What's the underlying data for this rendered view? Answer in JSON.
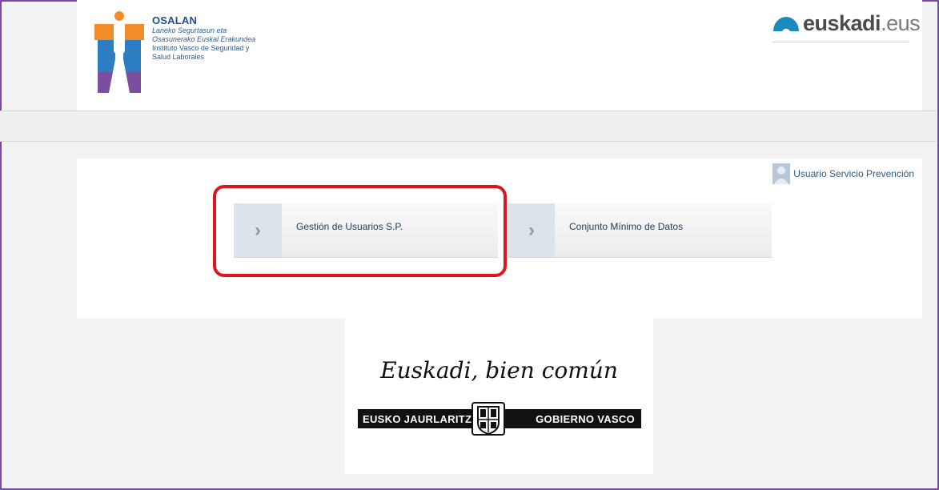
{
  "header": {
    "logo": {
      "title": "OSALAN",
      "line1": "Laneko Segurtasun eta",
      "line2": "Osasunerako Euskal Erakundea",
      "line3": "Instituto Vasco de Seguridad y",
      "line4": "Salud Laborales",
      "colors": {
        "orange": "#f28c28",
        "blue": "#2d7dc2",
        "purple": "#7a4fa0"
      }
    },
    "portal": {
      "name_bold": "euskadi",
      "name_suffix": ".eus",
      "icon": "euskadi-arc-icon"
    }
  },
  "user": {
    "name": "Usuario Servicio Prevención",
    "icon": "user-avatar-icon"
  },
  "menu": [
    {
      "label": "Gestión de Usuarios S.P.",
      "icon": "chevron-right-icon"
    },
    {
      "label": "Conjunto Mínimo de Datos",
      "icon": "chevron-right-icon"
    }
  ],
  "highlight_color": "#e0141d",
  "footer": {
    "slogan": "Euskadi, bien común",
    "left": "EUSKO JAURLARITZA",
    "right": "GOBIERNO VASCO",
    "icon": "coat-of-arms-icon"
  }
}
